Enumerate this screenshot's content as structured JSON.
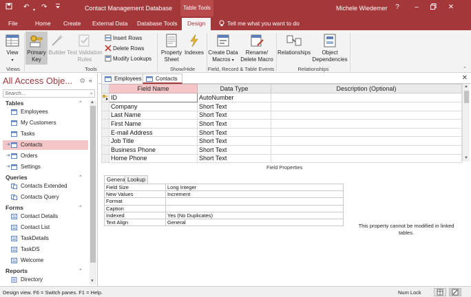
{
  "titlebar": {
    "document_title": "Contact Management Database",
    "contextual_tab": "Table Tools",
    "user_name": "Michele Wiedemer",
    "help": "?"
  },
  "ribbon_tabs": {
    "file": "File",
    "home": "Home",
    "create": "Create",
    "external_data": "External Data",
    "database_tools": "Database Tools",
    "design": "Design",
    "tell_me": "Tell me what you want to do"
  },
  "ribbon": {
    "view": "View",
    "primary_key_1": "Primary",
    "primary_key_2": "Key",
    "builder": "Builder",
    "test_rules_1": "Test Validation",
    "test_rules_2": "Rules",
    "insert_rows": "Insert Rows",
    "delete_rows": "Delete Rows",
    "modify_lookups": "Modify Lookups",
    "property_sheet_1": "Property",
    "property_sheet_2": "Sheet",
    "indexes": "Indexes",
    "create_macros_1": "Create Data",
    "create_macros_2": "Macros",
    "rename_macro_1": "Rename/",
    "rename_macro_2": "Delete Macro",
    "relationships": "Relationships",
    "object_deps_1": "Object",
    "object_deps_2": "Dependencies",
    "groups": {
      "views": "Views",
      "tools": "Tools",
      "show_hide": "Show/Hide",
      "field_record_table": "Field, Record & Table Events",
      "relationships": "Relationships"
    }
  },
  "nav": {
    "header": "All Access Obje...",
    "search_placeholder": "Search...",
    "categories": {
      "tables": "Tables",
      "queries": "Queries",
      "forms": "Forms",
      "reports": "Reports"
    },
    "tables": [
      "Employees",
      "My Customers",
      "Tasks",
      "Contacts",
      "Orders",
      "Settings"
    ],
    "queries": [
      "Contacts Extended",
      "Contacts Query"
    ],
    "forms": [
      "Contact Details",
      "Contact List",
      "TaskDetails",
      "TaskDS",
      "Welcome"
    ],
    "reports": [
      "Directory"
    ]
  },
  "doc_tabs": [
    "Employees",
    "Contacts"
  ],
  "design_grid": {
    "headers": [
      "Field Name",
      "Data Type",
      "Description (Optional)"
    ],
    "rows": [
      {
        "field": "ID",
        "type": "AutoNumber"
      },
      {
        "field": "Company",
        "type": "Short Text"
      },
      {
        "field": "Last Name",
        "type": "Short Text"
      },
      {
        "field": "First Name",
        "type": "Short Text"
      },
      {
        "field": "E-mail Address",
        "type": "Short Text"
      },
      {
        "field": "Job Title",
        "type": "Short Text"
      },
      {
        "field": "Business Phone",
        "type": "Short Text"
      },
      {
        "field": "Home Phone",
        "type": "Short Text"
      }
    ]
  },
  "field_properties": {
    "title": "Field Properties",
    "tabs": [
      "General",
      "Lookup"
    ],
    "rows": [
      {
        "k": "Field Size",
        "v": "Long Integer"
      },
      {
        "k": "New Values",
        "v": "Increment"
      },
      {
        "k": "Format",
        "v": ""
      },
      {
        "k": "Caption",
        "v": ""
      },
      {
        "k": "Indexed",
        "v": "Yes (No Duplicates)"
      },
      {
        "k": "Text Align",
        "v": "General"
      }
    ],
    "hint": "This property cannot be modified in linked tables."
  },
  "status": {
    "message": "Design view.  F6 = Switch panes.  F1 = Help.",
    "num_lock": "Num Lock"
  },
  "colors": {
    "accent": "#a4373a",
    "selected": "#f4c6c7"
  }
}
